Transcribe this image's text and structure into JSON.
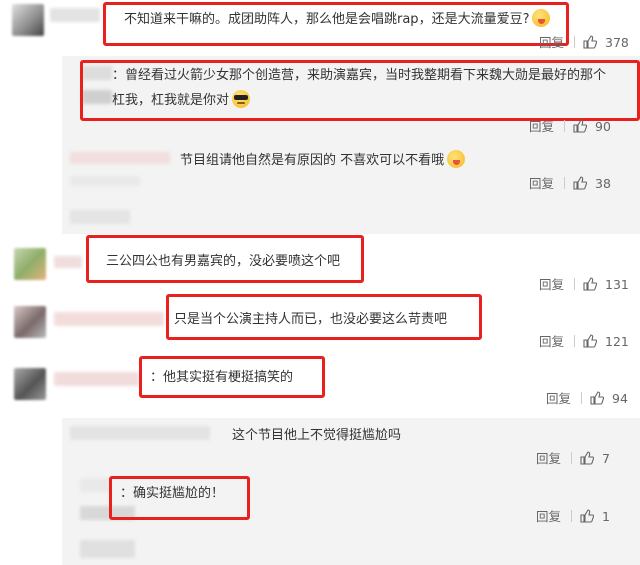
{
  "labels": {
    "reply": "回复"
  },
  "comments": [
    {
      "text": "不知道来干嘛的。成团助阵人，那么他是会唱跳rap，还是大流量爱豆?",
      "emoji": "lick",
      "likes": "378"
    },
    {
      "line1": "：曾经看过火箭少女那个创造营，来助演嘉宾，当时我整期看下来魏大勋是最好的那个",
      "line2": "杠我，杠我就是你对",
      "emoji": "cool",
      "likes": "90"
    },
    {
      "text": "节目组请他自然是有原因的 不喜欢可以不看哦",
      "emoji": "lick",
      "likes": "38"
    },
    {
      "text": "三公四公也有男嘉宾的，没必要喷这个吧",
      "likes": "131"
    },
    {
      "text": "只是当个公演主持人而已，也没必要这么苛责吧",
      "likes": "121"
    },
    {
      "text": "：他其实挺有梗挺搞笑的",
      "likes": "94"
    },
    {
      "text": "这个节目他上不觉得挺尴尬吗",
      "likes": "7"
    },
    {
      "text": "：确实挺尴尬的！",
      "likes": "1"
    }
  ]
}
